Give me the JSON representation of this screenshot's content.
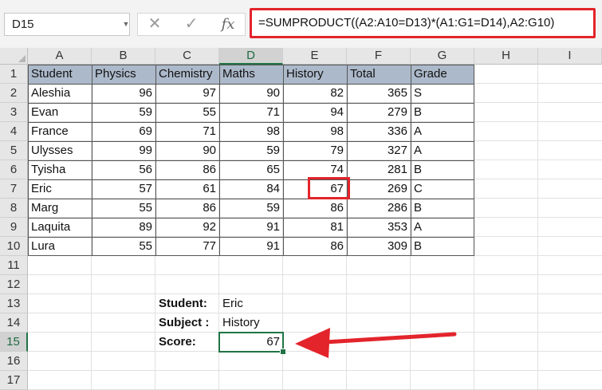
{
  "namebox": {
    "value": "D15"
  },
  "formula_bar": {
    "cancel_glyph": "✕",
    "enter_glyph": "✓",
    "fx_label": "fx",
    "formula": "=SUMPRODUCT((A2:A10=D13)*(A1:G1=D14),A2:G10)"
  },
  "columns": [
    "A",
    "B",
    "C",
    "D",
    "E",
    "F",
    "G",
    "H",
    "I"
  ],
  "rows": [
    "1",
    "2",
    "3",
    "4",
    "5",
    "6",
    "7",
    "8",
    "9",
    "10",
    "11",
    "12",
    "13",
    "14",
    "15",
    "16",
    "17"
  ],
  "table": {
    "headers": [
      "Student",
      "Physics",
      "Chemistry",
      "Maths",
      "History",
      "Total",
      "Grade"
    ],
    "data": [
      [
        "Aleshia",
        "96",
        "97",
        "90",
        "82",
        "365",
        "S"
      ],
      [
        "Evan",
        "59",
        "55",
        "71",
        "94",
        "279",
        "B"
      ],
      [
        "France",
        "69",
        "71",
        "98",
        "98",
        "336",
        "A"
      ],
      [
        "Ulysses",
        "99",
        "90",
        "59",
        "79",
        "327",
        "A"
      ],
      [
        "Tyisha",
        "56",
        "86",
        "65",
        "74",
        "281",
        "B"
      ],
      [
        "Eric",
        "57",
        "61",
        "84",
        "67",
        "269",
        "C"
      ],
      [
        "Marg",
        "55",
        "86",
        "59",
        "86",
        "286",
        "B"
      ],
      [
        "Laquita",
        "89",
        "92",
        "91",
        "81",
        "353",
        "A"
      ],
      [
        "Lura",
        "55",
        "77",
        "91",
        "86",
        "309",
        "B"
      ]
    ]
  },
  "lookup": {
    "student_label": "Student:",
    "student_value": "Eric",
    "subject_label": "Subject :",
    "subject_value": "History",
    "score_label": "Score:",
    "score_value": "67"
  },
  "colors": {
    "highlight": "#e3242b",
    "selection": "#217346",
    "header_band": "#acb9ca"
  }
}
